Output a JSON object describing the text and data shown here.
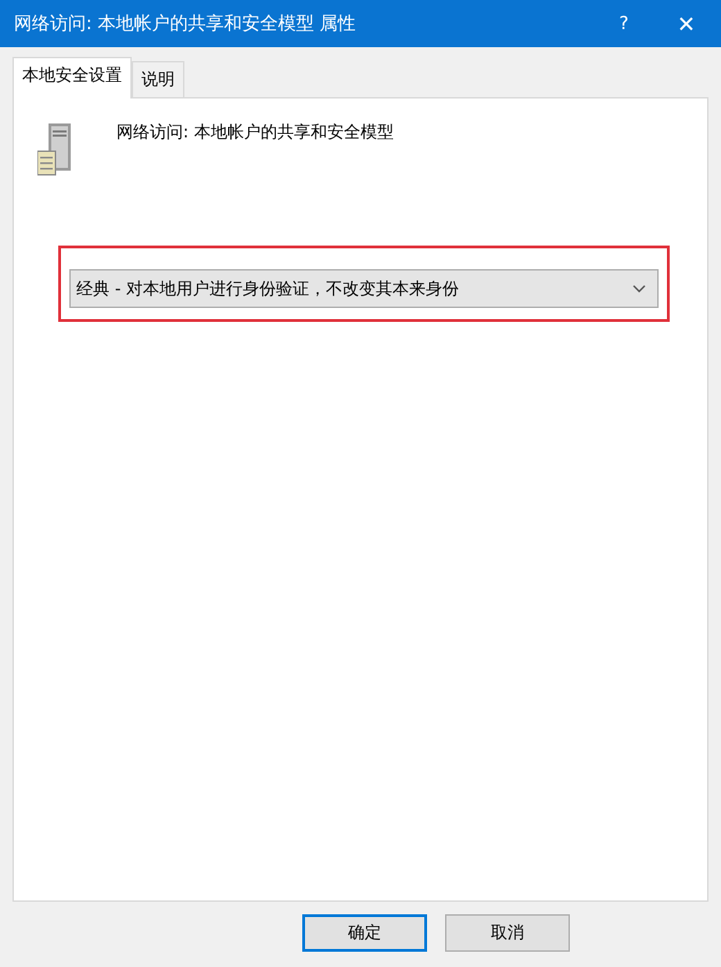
{
  "window": {
    "title": "网络访问: 本地帐户的共享和安全模型 属性",
    "buttons": [
      {
        "kind": "help",
        "label": "?"
      },
      {
        "kind": "close",
        "label": "✕"
      }
    ]
  },
  "tabs": [
    {
      "label": "本地安全设置",
      "selected": true
    },
    {
      "label": "说明",
      "selected": false
    }
  ],
  "policy": {
    "title": "网络访问: 本地帐户的共享和安全模型"
  },
  "dropdown": {
    "value": "经典 - 对本地用户进行身份验证，不改变其本来身份",
    "highlighted": true
  },
  "buttons": [
    {
      "label": "确定",
      "default": true
    },
    {
      "label": "取消",
      "default": false
    }
  ]
}
